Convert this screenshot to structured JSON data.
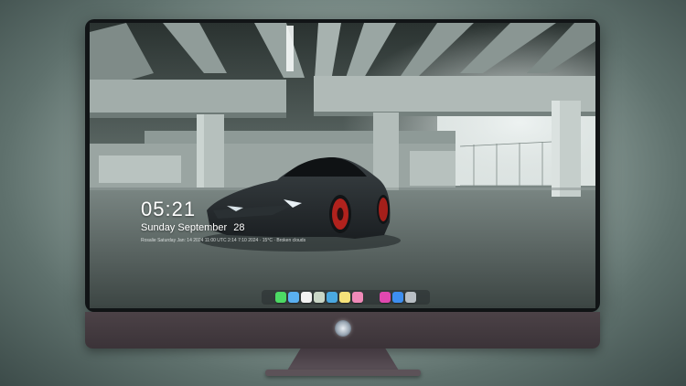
{
  "lock_screen": {
    "time": "05:21",
    "weekday": "Sunday",
    "month": "September",
    "day": "28",
    "status_line": "Rosalie Saturday Jan: 14 2024 11:00 UTC 2:14 7:10 2024 · 15°C · Broken clouds"
  },
  "dock": {
    "apps": [
      {
        "name": "messages-icon",
        "color": "#4cd964"
      },
      {
        "name": "finder-icon",
        "color": "#5ab0f0"
      },
      {
        "name": "clock-icon",
        "color": "#f2f2f2"
      },
      {
        "name": "preview-icon",
        "color": "#c9d6c6"
      },
      {
        "name": "clapperboard-icon",
        "color": "#4aa8e0"
      },
      {
        "name": "notes-icon",
        "color": "#f5e27a"
      },
      {
        "name": "photos-icon",
        "color": "#f08ab8"
      },
      {
        "name": "music-icon",
        "color": "#e048b0"
      },
      {
        "name": "app-store-icon",
        "color": "#3d8ef0"
      },
      {
        "name": "camera-icon",
        "color": "#b8bec4"
      }
    ]
  }
}
